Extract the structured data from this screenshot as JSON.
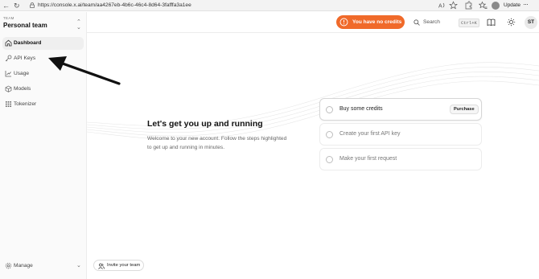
{
  "browser": {
    "url": "https://console.x.ai/team/aa4267eb-4b6c-46c4-8d64-3fafffa3a1ee",
    "update_label": "Update",
    "menu_dots": "···"
  },
  "sidebar": {
    "team_label": "TEAM",
    "team_name": "Personal team",
    "items": [
      {
        "label": "Dashboard",
        "icon": "home-icon",
        "active": true
      },
      {
        "label": "API Keys",
        "icon": "key-icon",
        "active": false
      },
      {
        "label": "Usage",
        "icon": "chart-icon",
        "active": false
      },
      {
        "label": "Models",
        "icon": "cube-icon",
        "active": false
      },
      {
        "label": "Tokenizer",
        "icon": "grid-icon",
        "active": false
      }
    ],
    "manage_label": "Manage"
  },
  "topbar": {
    "credits_label": "You have no credits",
    "search_label": "Search",
    "search_shortcut": "Ctrl+K",
    "user_initials": "ST"
  },
  "main": {
    "title": "Let's get you up and running",
    "description": "Welcome to your new account. Follow the steps highlighted to get up and running in minutes.",
    "steps": [
      {
        "label": "Buy some credits",
        "action": "Purchase"
      },
      {
        "label": "Create your first API key"
      },
      {
        "label": "Make your first request"
      }
    ],
    "invite_label": "Invite your team"
  },
  "colors": {
    "accent": "#f06a2a",
    "sidebar_bg": "#fafafa"
  }
}
